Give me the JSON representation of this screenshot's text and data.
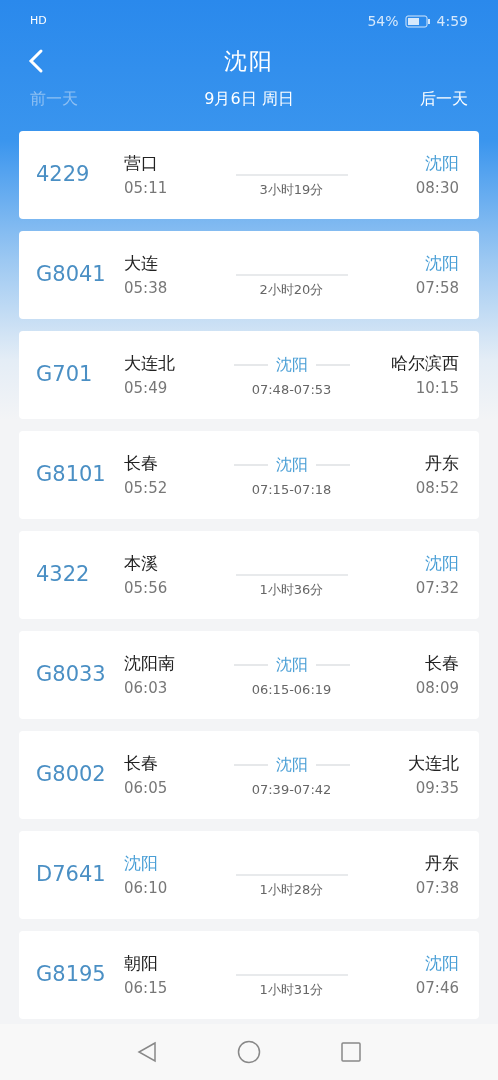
{
  "status_bar": {
    "left_icons": "HD",
    "battery_percent": "54%",
    "time": "4:59"
  },
  "header": {
    "title": "沈阳"
  },
  "date_nav": {
    "prev": {
      "label": "前一天",
      "disabled": true
    },
    "date": "9月6日 周日",
    "next": {
      "label": "后一天",
      "disabled": false
    }
  },
  "trains": [
    {
      "number": "4229",
      "from": {
        "name": "营口",
        "highlight": false
      },
      "depart": "05:11",
      "middle": {
        "kind": "duration",
        "text": "3小时19分"
      },
      "to": {
        "name": "沈阳",
        "highlight": true
      },
      "arrive": "08:30"
    },
    {
      "number": "G8041",
      "from": {
        "name": "大连",
        "highlight": false
      },
      "depart": "05:38",
      "middle": {
        "kind": "duration",
        "text": "2小时20分"
      },
      "to": {
        "name": "沈阳",
        "highlight": true
      },
      "arrive": "07:58"
    },
    {
      "number": "G701",
      "from": {
        "name": "大连北",
        "highlight": false
      },
      "depart": "05:49",
      "middle": {
        "kind": "stop",
        "station": "沈阳",
        "text": "07:48-07:53"
      },
      "to": {
        "name": "哈尔滨西",
        "highlight": false
      },
      "arrive": "10:15"
    },
    {
      "number": "G8101",
      "from": {
        "name": "长春",
        "highlight": false
      },
      "depart": "05:52",
      "middle": {
        "kind": "stop",
        "station": "沈阳",
        "text": "07:15-07:18"
      },
      "to": {
        "name": "丹东",
        "highlight": false
      },
      "arrive": "08:52"
    },
    {
      "number": "4322",
      "from": {
        "name": "本溪",
        "highlight": false
      },
      "depart": "05:56",
      "middle": {
        "kind": "duration",
        "text": "1小时36分"
      },
      "to": {
        "name": "沈阳",
        "highlight": true
      },
      "arrive": "07:32"
    },
    {
      "number": "G8033",
      "from": {
        "name": "沈阳南",
        "highlight": false
      },
      "depart": "06:03",
      "middle": {
        "kind": "stop",
        "station": "沈阳",
        "text": "06:15-06:19"
      },
      "to": {
        "name": "长春",
        "highlight": false
      },
      "arrive": "08:09"
    },
    {
      "number": "G8002",
      "from": {
        "name": "长春",
        "highlight": false
      },
      "depart": "06:05",
      "middle": {
        "kind": "stop",
        "station": "沈阳",
        "text": "07:39-07:42"
      },
      "to": {
        "name": "大连北",
        "highlight": false
      },
      "arrive": "09:35"
    },
    {
      "number": "D7641",
      "from": {
        "name": "沈阳",
        "highlight": true
      },
      "depart": "06:10",
      "middle": {
        "kind": "duration",
        "text": "1小时28分"
      },
      "to": {
        "name": "丹东",
        "highlight": false
      },
      "arrive": "07:38"
    },
    {
      "number": "G8195",
      "from": {
        "name": "朝阳",
        "highlight": false
      },
      "depart": "06:15",
      "middle": {
        "kind": "duration",
        "text": "1小时31分"
      },
      "to": {
        "name": "沈阳",
        "highlight": true
      },
      "arrive": "07:46"
    }
  ]
}
